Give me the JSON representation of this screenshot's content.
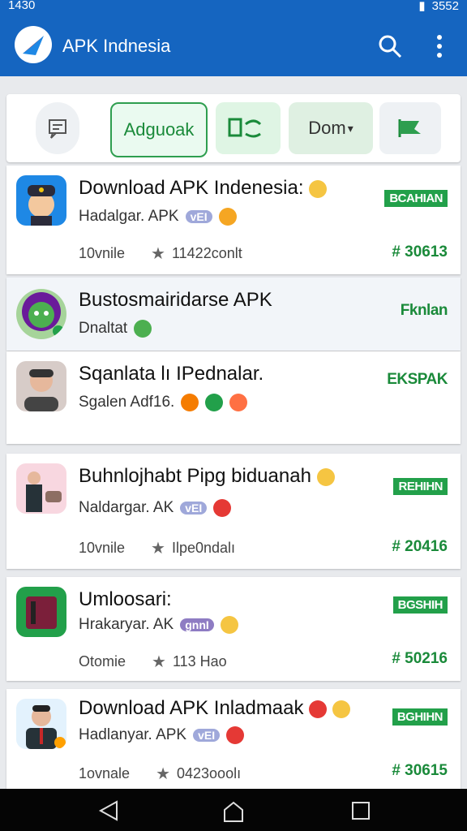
{
  "status": {
    "time": "1430",
    "right": "3552"
  },
  "header": {
    "title": "APK Indnesia"
  },
  "filters": [
    "Adguoak",
    "Dom"
  ],
  "apps": [
    {
      "title": "Download APK Indenesia:",
      "dev": "Hadalgar. APK",
      "pill": "vEI",
      "size": "10vnile",
      "rating": "11422conlt",
      "badge": "BCAHIAN",
      "price": "# 30613"
    },
    {
      "title": "Bustosmairidarse APK",
      "dev": "Dnaltat",
      "badge": "Fknlan"
    },
    {
      "title": "Sqanlata lı IPednalar.",
      "dev": "Sgalen  Adf16.",
      "badge": "EKSPAK"
    },
    {
      "title": "Buhnlojhabt Pipg biduanah",
      "dev": "Naldargar. AK",
      "pill": "vEI",
      "size": "10vnile",
      "rating": "Ilpe0ndalı",
      "badge": "REHIHN",
      "price": "# 20416"
    },
    {
      "title": "Umloosari:",
      "dev": "Hrakaryar. AK",
      "pill": "gnnI",
      "size": "Otomie",
      "rating": "113 Hao",
      "badge": "BGSHIH",
      "price": "# 50216"
    },
    {
      "title": "Download APK Inladmaak",
      "dev": "Hadlanyar. APK",
      "pill": "vEI",
      "size": "1ovnale",
      "rating": "0423ooolı",
      "badge": "BGHIHN",
      "price": "# 30615"
    }
  ],
  "colors": {
    "appbar": "#1565c0",
    "green": "#22a04a"
  },
  "icons": [
    "search-icon",
    "more-vert-icon",
    "chat-icon",
    "back-icon",
    "home-icon",
    "recents-icon"
  ]
}
